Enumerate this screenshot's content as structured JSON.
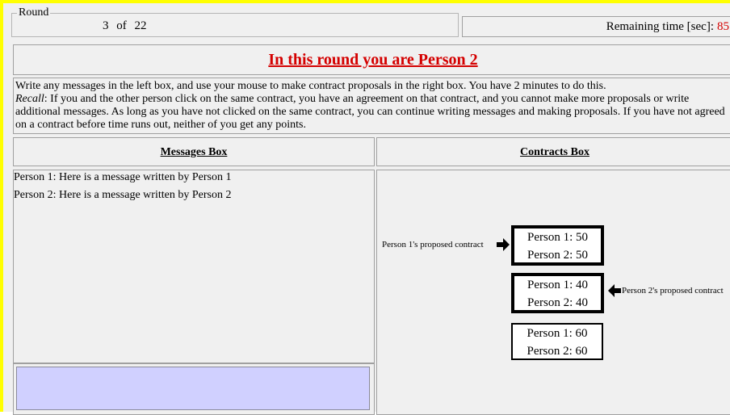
{
  "round": {
    "legend": "Round",
    "current": "3",
    "of_label": "of",
    "total": "22"
  },
  "timer": {
    "label": "Remaining time [sec]:",
    "value": "85",
    "value_color": "#d40000"
  },
  "title": "In this round you are Person 2",
  "instructions": {
    "line1": "Write any messages in the left box, and use your mouse to make contract proposals in the right box. You have 2 minutes to do this.",
    "recall_label": "Recall",
    "recall_text": ": If you and the other person click on the same contract, you have an agreement on that contract, and you cannot make more proposals or write additional messages. As long as you have not clicked on the same contract, you can continue writing messages and making proposals. If you have not agreed on a contract before time runs out, neither of you get any points."
  },
  "messages_box": {
    "header": "Messages Box",
    "messages": [
      "Person 1: Here is a message written by Person 1",
      "Person 2: Here is a message written by Person 2"
    ],
    "input_value": "",
    "input_color": "#d0d0ff"
  },
  "contracts_box": {
    "header": "Contracts Box",
    "contracts": [
      {
        "p1": "Person 1: 50",
        "p2": "Person 2: 50"
      },
      {
        "p1": "Person 1: 40",
        "p2": "Person 2: 40"
      },
      {
        "p1": "Person 1: 60",
        "p2": "Person 2: 60"
      }
    ],
    "p1_proposal_label": "Person 1's proposed contract",
    "p2_proposal_label": "Person 2's proposed contract"
  },
  "icons": {
    "p1_arrow": "arrow-right-icon",
    "p2_arrow": "arrow-left-icon"
  }
}
